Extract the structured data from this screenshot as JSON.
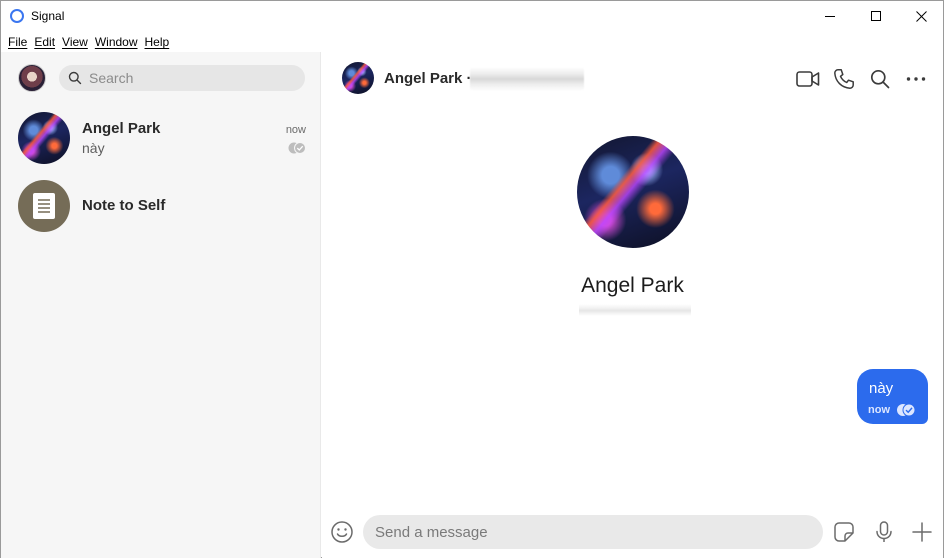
{
  "window": {
    "title": "Signal",
    "controls": [
      "minimize",
      "maximize",
      "close"
    ]
  },
  "menu": {
    "items": [
      "File",
      "Edit",
      "View",
      "Window",
      "Help"
    ]
  },
  "sidebar": {
    "search_placeholder": "Search",
    "conversations": [
      {
        "name": "Angel Park",
        "preview": "này",
        "time": "now",
        "status": "read"
      },
      {
        "name": "Note to Self",
        "preview": "",
        "time": "",
        "avatar_icon": "note-icon"
      }
    ]
  },
  "conversation": {
    "header_name": "Angel Park ·",
    "header_actions": [
      "video-call-icon",
      "voice-call-icon",
      "search-icon",
      "more-icon"
    ],
    "profile_name": "Angel Park",
    "messages": [
      {
        "direction": "outgoing",
        "text": "này",
        "time": "now",
        "status": "read"
      }
    ],
    "composer_placeholder": "Send a message"
  },
  "colors": {
    "accent": "#2c6bed",
    "sidebar_bg": "#f6f6f6",
    "note_avatar": "#756c57"
  }
}
